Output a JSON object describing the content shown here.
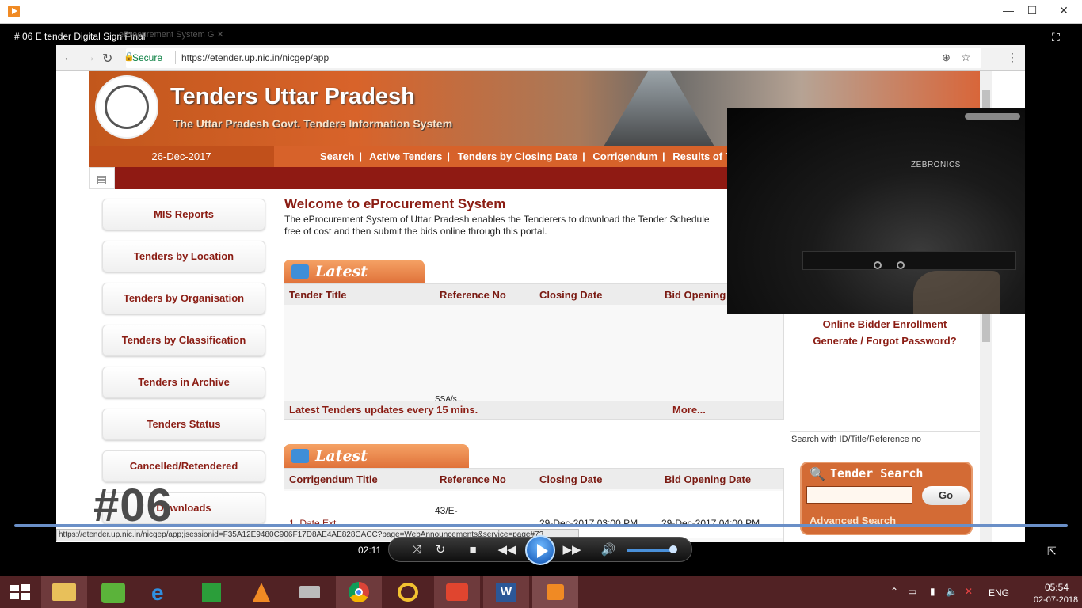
{
  "window": {
    "title": "",
    "minimize": "—",
    "maximize": "☐",
    "close": "✕"
  },
  "video": {
    "title": "# 06 E tender Digital Sign Final",
    "time": "02:11",
    "overlay_number": "#06"
  },
  "browser": {
    "tab_label": "eProcurement System G",
    "secure_label": "Secure",
    "url": "https://etender.up.nic.in/nicgep/app",
    "status_url": "https://etender.up.nic.in/nicgep/app;jsessionid=F35A12E9480C906F17D8AE4AE828CACC?page=WebAnnouncements&service=page#73"
  },
  "site": {
    "title": "Tenders Uttar Pradesh",
    "subtitle": "The Uttar Pradesh Govt. Tenders Information System",
    "date": "26-Dec-2017",
    "nav": [
      "Search",
      "Active Tenders",
      "Tenders by Closing Date",
      "Corrigendum",
      "Results of Tenders"
    ]
  },
  "left_nav": [
    "MIS Reports",
    "Tenders by Location",
    "Tenders by Organisation",
    "Tenders by Classification",
    "Tenders in Archive",
    "Tenders Status",
    "Cancelled/Retendered",
    "Downloads"
  ],
  "welcome": {
    "title": "Welcome to eProcurement System",
    "text": "The eProcurement System of Uttar Pradesh enables the Tenderers to download the Tender Schedule free of cost and then submit the bids online through this portal."
  },
  "latest_tenders": {
    "heading": "Latest Tenders",
    "columns": [
      "Tender Title",
      "Reference No",
      "Closing Date",
      "Bid Opening Date"
    ],
    "partial_cell": "SSA/s...",
    "footer_text": "Latest Tenders updates every 15 mins.",
    "more": "More..."
  },
  "latest_corrigendums": {
    "heading": "Latest Corrigendums",
    "columns": [
      "Corrigendum Title",
      "Reference No",
      "Closing Date",
      "Bid Opening Date"
    ],
    "rows": [
      {
        "title": "1. Date Ext.",
        "ref": "43/E-",
        "closing": "29-Dec-2017 03:00 PM",
        "opening": "29-Dec-2017 04:00 PM"
      }
    ]
  },
  "right_panel": {
    "enroll": "Online Bidder Enrollment",
    "forgot": "Generate / Forgot Password?",
    "search_hint": "Search with ID/Title/Reference no",
    "search_title": "Tender Search",
    "go": "Go",
    "advanced": "Advanced Search",
    "search_value": ""
  },
  "pip": {
    "brand": "ZEBRONICS"
  },
  "clock": {
    "time": "05:54",
    "date": "02-07-2018"
  },
  "tray": {
    "lang": "ENG"
  },
  "colors": {
    "accent": "#d7622a",
    "dark_red": "#8f1a13",
    "text_red": "#8b1d14",
    "taskbar": "#512224"
  }
}
